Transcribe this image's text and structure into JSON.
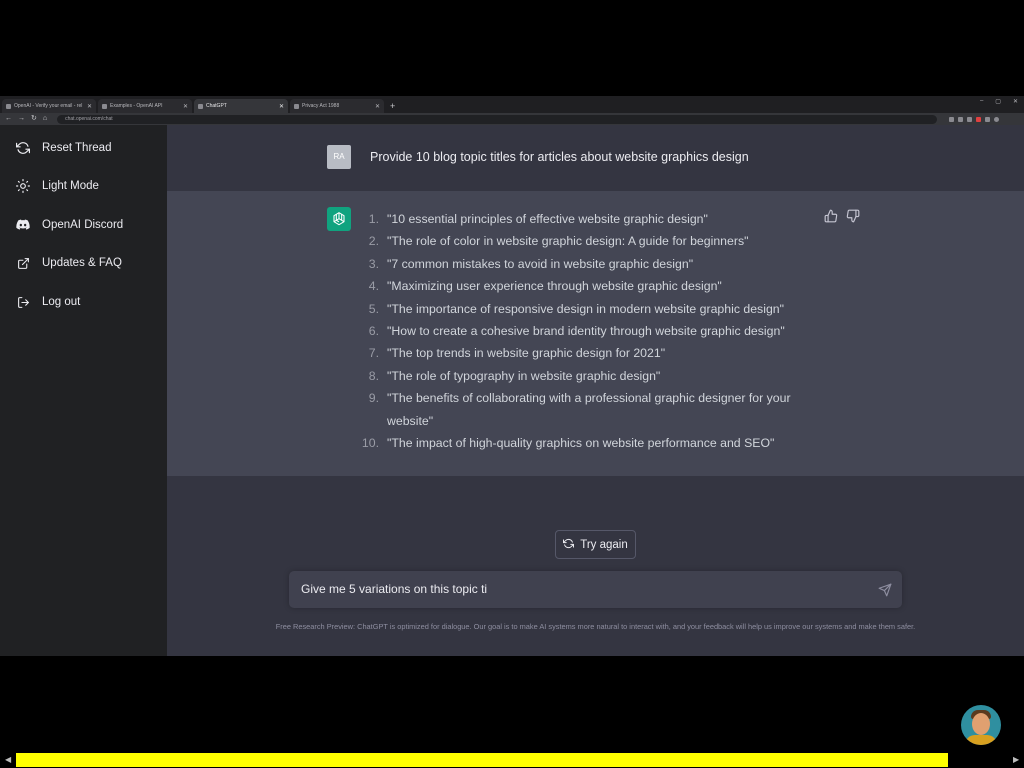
{
  "browser": {
    "tabs": [
      {
        "title": "OpenAI - Verify your email - rel",
        "active": false
      },
      {
        "title": "Examples - OpenAI API",
        "active": false
      },
      {
        "title": "ChatGPT",
        "active": true
      },
      {
        "title": "Privacy Act 1988",
        "active": false
      }
    ],
    "new_tab_label": "+",
    "url": "chat.openai.com/chat"
  },
  "sidebar": {
    "items": [
      {
        "label": "Reset Thread",
        "icon": "refresh-icon"
      },
      {
        "label": "Light Mode",
        "icon": "sun-icon"
      },
      {
        "label": "OpenAI Discord",
        "icon": "discord-icon"
      },
      {
        "label": "Updates & FAQ",
        "icon": "external-link-icon"
      },
      {
        "label": "Log out",
        "icon": "logout-icon"
      }
    ]
  },
  "conversation": {
    "user": {
      "avatar_initials": "RA",
      "message": "Provide 10 blog topic titles for articles about website graphics design"
    },
    "assistant": {
      "items": [
        {
          "num": "1.",
          "text": "\"10 essential principles of effective website graphic design\""
        },
        {
          "num": "2.",
          "text": "\"The role of color in website graphic design: A guide for beginners\""
        },
        {
          "num": "3.",
          "text": "\"7 common mistakes to avoid in website graphic design\""
        },
        {
          "num": "4.",
          "text": "\"Maximizing user experience through website graphic design\""
        },
        {
          "num": "5.",
          "text": "\"The importance of responsive design in modern website graphic design\""
        },
        {
          "num": "6.",
          "text": "\"How to create a cohesive brand identity through website graphic design\""
        },
        {
          "num": "7.",
          "text": "\"The top trends in website graphic design for 2021\""
        },
        {
          "num": "8.",
          "text": "\"The role of typography in website graphic design\""
        },
        {
          "num": "9.",
          "text": "\"The benefits of collaborating with a professional graphic designer for your website\""
        },
        {
          "num": "10.",
          "text": "\"The impact of high-quality graphics on website performance and SEO\""
        }
      ]
    }
  },
  "try_again_label": "Try again",
  "composer": {
    "value": "Give me 5 variations on this topic ti"
  },
  "footer_note": "Free Research Preview: ChatGPT is optimized for dialogue. Our goal is to make AI systems more natural to interact with, and your feedback will help us improve our systems and make them safer.",
  "video_player": {
    "progress": 0.94
  },
  "colors": {
    "sidebar": "#202123",
    "main_bg": "#343541",
    "assistant_bg": "#444654",
    "brand": "#10a37f",
    "progress": "#ffff00"
  }
}
